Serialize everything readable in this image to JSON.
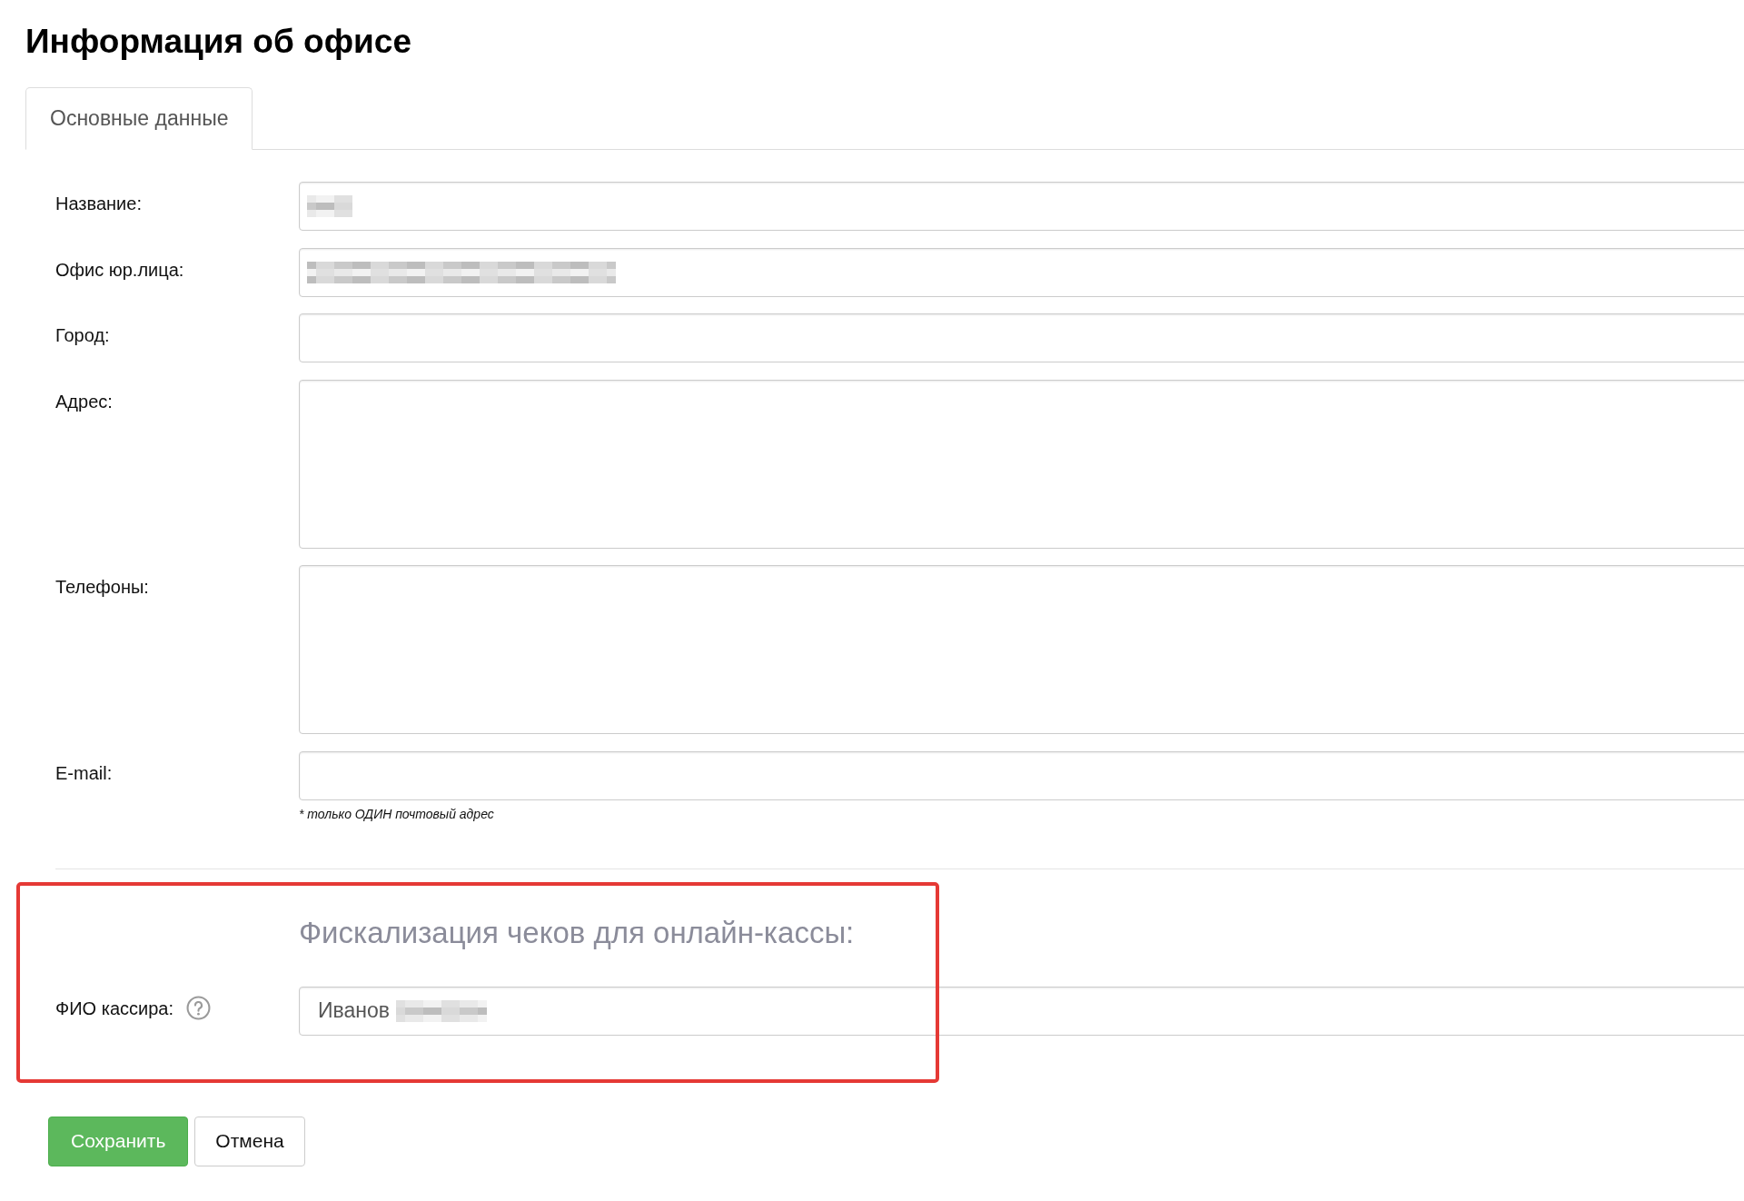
{
  "page": {
    "title": "Информация об офисе"
  },
  "tabs": [
    {
      "label": "Основные данные",
      "selected": true
    }
  ],
  "fields": [
    {
      "label": "Название:",
      "kind": "input",
      "redacted": true
    },
    {
      "label": "Офис юр.лица:",
      "kind": "input",
      "redacted": true
    },
    {
      "label": "Город:",
      "kind": "input",
      "redacted": false
    },
    {
      "label": "Адрес:",
      "kind": "textarea",
      "redacted": false
    },
    {
      "label": "Телефоны:",
      "kind": "textarea",
      "redacted": false
    },
    {
      "label": "E-mail:",
      "kind": "input",
      "redacted": false,
      "hint": "* только ОДИН почтовый адрес"
    }
  ],
  "fiscal_section": {
    "heading": "Фискализация чеков для онлайн-кассы:",
    "highlighted": true,
    "fields": [
      {
        "label": "ФИО кассира:",
        "kind": "input",
        "value": "Иванов",
        "help": true,
        "redacted": true
      }
    ]
  },
  "buttons": [
    {
      "label": "Сохранить",
      "kind": "primary"
    },
    {
      "label": "Отмена",
      "kind": "default"
    }
  ]
}
